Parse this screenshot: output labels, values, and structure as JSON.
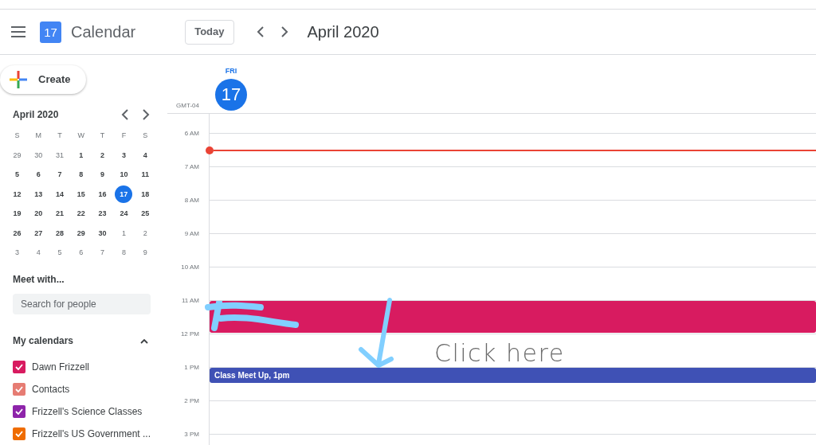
{
  "header": {
    "app_name": "Calendar",
    "logo_day": "17",
    "today_button": "Today",
    "title": "April 2020"
  },
  "create_button": "Create",
  "mini_calendar": {
    "title": "April 2020",
    "weekdays": [
      "S",
      "M",
      "T",
      "W",
      "T",
      "F",
      "S"
    ],
    "weeks": [
      [
        {
          "d": "29",
          "other": true,
          "selected": false
        },
        {
          "d": "30",
          "other": true,
          "selected": false
        },
        {
          "d": "31",
          "other": true,
          "selected": false
        },
        {
          "d": "1",
          "other": false,
          "selected": false
        },
        {
          "d": "2",
          "other": false,
          "selected": false
        },
        {
          "d": "3",
          "other": false,
          "selected": false
        },
        {
          "d": "4",
          "other": false,
          "selected": false
        }
      ],
      [
        {
          "d": "5",
          "other": false,
          "selected": false
        },
        {
          "d": "6",
          "other": false,
          "selected": false
        },
        {
          "d": "7",
          "other": false,
          "selected": false
        },
        {
          "d": "8",
          "other": false,
          "selected": false
        },
        {
          "d": "9",
          "other": false,
          "selected": false
        },
        {
          "d": "10",
          "other": false,
          "selected": false
        },
        {
          "d": "11",
          "other": false,
          "selected": false
        }
      ],
      [
        {
          "d": "12",
          "other": false,
          "selected": false
        },
        {
          "d": "13",
          "other": false,
          "selected": false
        },
        {
          "d": "14",
          "other": false,
          "selected": false
        },
        {
          "d": "15",
          "other": false,
          "selected": false
        },
        {
          "d": "16",
          "other": false,
          "selected": false
        },
        {
          "d": "17",
          "other": false,
          "selected": true
        },
        {
          "d": "18",
          "other": false,
          "selected": false
        }
      ],
      [
        {
          "d": "19",
          "other": false,
          "selected": false
        },
        {
          "d": "20",
          "other": false,
          "selected": false
        },
        {
          "d": "21",
          "other": false,
          "selected": false
        },
        {
          "d": "22",
          "other": false,
          "selected": false
        },
        {
          "d": "23",
          "other": false,
          "selected": false
        },
        {
          "d": "24",
          "other": false,
          "selected": false
        },
        {
          "d": "25",
          "other": false,
          "selected": false
        }
      ],
      [
        {
          "d": "26",
          "other": false,
          "selected": false
        },
        {
          "d": "27",
          "other": false,
          "selected": false
        },
        {
          "d": "28",
          "other": false,
          "selected": false
        },
        {
          "d": "29",
          "other": false,
          "selected": false
        },
        {
          "d": "30",
          "other": false,
          "selected": false
        },
        {
          "d": "1",
          "other": true,
          "selected": false
        },
        {
          "d": "2",
          "other": true,
          "selected": false
        }
      ],
      [
        {
          "d": "3",
          "other": true,
          "selected": false
        },
        {
          "d": "4",
          "other": true,
          "selected": false
        },
        {
          "d": "5",
          "other": true,
          "selected": false
        },
        {
          "d": "6",
          "other": true,
          "selected": false
        },
        {
          "d": "7",
          "other": true,
          "selected": false
        },
        {
          "d": "8",
          "other": true,
          "selected": false
        },
        {
          "d": "9",
          "other": true,
          "selected": false
        }
      ]
    ]
  },
  "meet_with": {
    "title": "Meet with...",
    "placeholder": "Search for people"
  },
  "my_calendars": {
    "title": "My calendars",
    "expanded": true,
    "items": [
      {
        "label": "Dawn Frizzell",
        "checked": true,
        "color": "#d81b60"
      },
      {
        "label": "Contacts",
        "checked": true,
        "color": "#e67c73"
      },
      {
        "label": "Frizzell's Science Classes",
        "checked": true,
        "color": "#8e24aa"
      },
      {
        "label": "Frizzell's US Government ...",
        "checked": true,
        "color": "#ef6c00"
      }
    ]
  },
  "day": {
    "weekday": "FRI",
    "date": "17",
    "timezone": "GMT-04",
    "hours": [
      {
        "label": "6 AM"
      },
      {
        "label": "7 AM"
      },
      {
        "label": "8 AM"
      },
      {
        "label": "9 AM"
      },
      {
        "label": "10 AM"
      },
      {
        "label": "11 AM",
        "events": [
          {
            "kind": "redacted",
            "color": "#d81b60"
          }
        ]
      },
      {
        "label": "12 PM"
      },
      {
        "label": "1 PM",
        "events": [
          {
            "kind": "short",
            "title": "Class Meet Up, 1pm",
            "color": "#3f51b5"
          }
        ]
      },
      {
        "label": "2 PM"
      },
      {
        "label": "3 PM"
      }
    ]
  },
  "annotation": {
    "text": "Click here"
  }
}
